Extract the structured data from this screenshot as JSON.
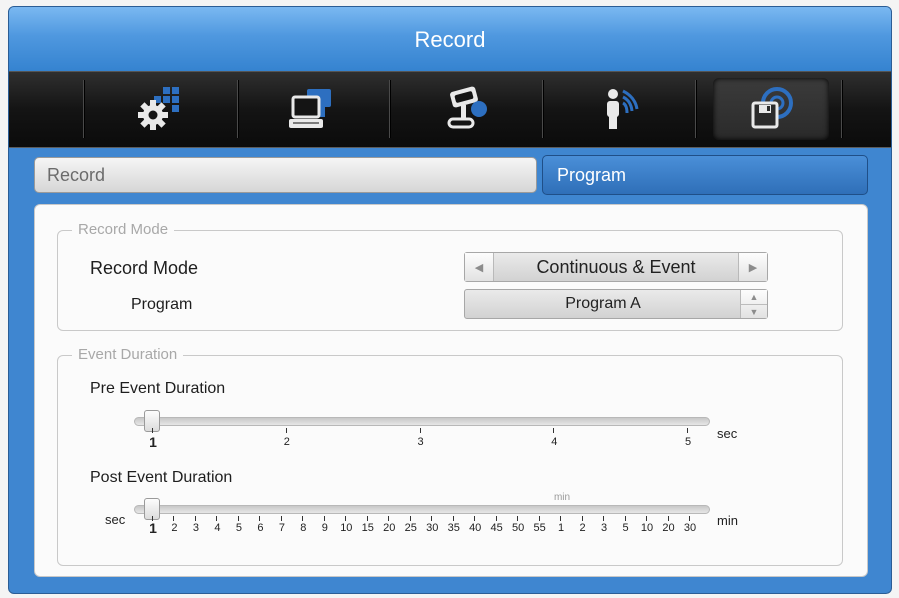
{
  "window": {
    "title": "Record"
  },
  "toolbar": {
    "items": [
      {
        "icon": "system-settings-icon"
      },
      {
        "icon": "network-computer-icon"
      },
      {
        "icon": "ptz-joystick-icon"
      },
      {
        "icon": "event-person-icon"
      },
      {
        "icon": "record-disk-icon",
        "active": true
      }
    ]
  },
  "tabs": {
    "record": "Record",
    "program": "Program",
    "active": "Program"
  },
  "record_mode_group": {
    "legend": "Record Mode",
    "record_mode_label": "Record Mode",
    "record_mode_value": "Continuous & Event",
    "program_label": "Program",
    "program_value": "Program A"
  },
  "event_duration_group": {
    "legend": "Event Duration",
    "pre": {
      "label": "Pre Event Duration",
      "ticks": [
        "1",
        "2",
        "3",
        "4",
        "5"
      ],
      "unit": "sec",
      "value": "1"
    },
    "post": {
      "label": "Post Event Duration",
      "left_unit": "sec",
      "ticks": [
        "1",
        "2",
        "3",
        "4",
        "5",
        "6",
        "7",
        "8",
        "9",
        "10",
        "15",
        "20",
        "25",
        "30",
        "35",
        "40",
        "45",
        "50",
        "55",
        "1",
        "2",
        "3",
        "5",
        "10",
        "20",
        "30"
      ],
      "min_marker": "min",
      "unit": "min",
      "value": "1"
    }
  },
  "colors": {
    "accent": "#3f86d0",
    "toolbar": "#141414",
    "active_tab": "#2f6fb8"
  }
}
